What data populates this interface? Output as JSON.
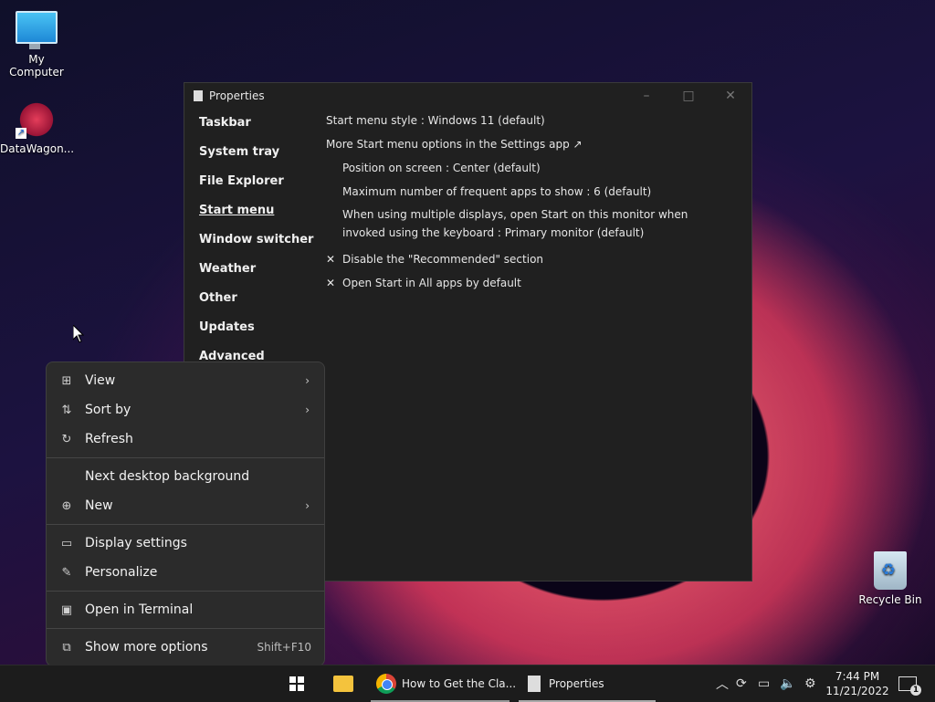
{
  "desktop": {
    "icons": [
      {
        "label": "My Computer"
      },
      {
        "label": "DataWagon..."
      },
      {
        "label": "Recycle Bin"
      }
    ]
  },
  "window": {
    "title": "Properties",
    "nav": [
      "Taskbar",
      "System tray",
      "File Explorer",
      "Start menu",
      "Window switcher",
      "Weather",
      "Other",
      "Updates",
      "Advanced"
    ],
    "active_nav": "Start menu",
    "options": {
      "start_style": "Start menu style : Windows 11 (default)",
      "more_options": "More Start menu options in the Settings app ↗",
      "position": "Position on screen : Center (default)",
      "max_apps": "Maximum number of frequent apps to show : 6 (default)",
      "multi_display": "When using multiple displays, open Start on this monitor when invoked using the keyboard : Primary monitor (default)",
      "disable_recommended": "Disable the \"Recommended\" section",
      "open_all_apps": "Open Start in All apps by default",
      "check_mark": "✕"
    }
  },
  "context_menu": {
    "items": [
      {
        "label": "View",
        "icon": "grid-icon",
        "glyph": "⊞"
      },
      {
        "label": "Sort by",
        "icon": "sort-icon",
        "glyph": "⇅"
      },
      {
        "label": "Refresh",
        "icon": "refresh-icon",
        "glyph": "↻"
      },
      {
        "label": "Next desktop background"
      },
      {
        "label": "New",
        "icon": "new-icon",
        "glyph": "⊕"
      },
      {
        "label": "Display settings",
        "icon": "display-icon",
        "glyph": "▭"
      },
      {
        "label": "Personalize",
        "icon": "pen-icon",
        "glyph": "✎"
      },
      {
        "label": "Open in Terminal",
        "icon": "terminal-icon",
        "glyph": "▣"
      },
      {
        "label": "Show more options",
        "icon": "expand-icon",
        "glyph": "⧉",
        "shortcut": "Shift+F10"
      }
    ]
  },
  "taskbar": {
    "chrome_label": "How to Get the Cla...",
    "properties_label": "Properties",
    "time": "7:44 PM",
    "date": "11/21/2022",
    "notif_count": "1"
  }
}
